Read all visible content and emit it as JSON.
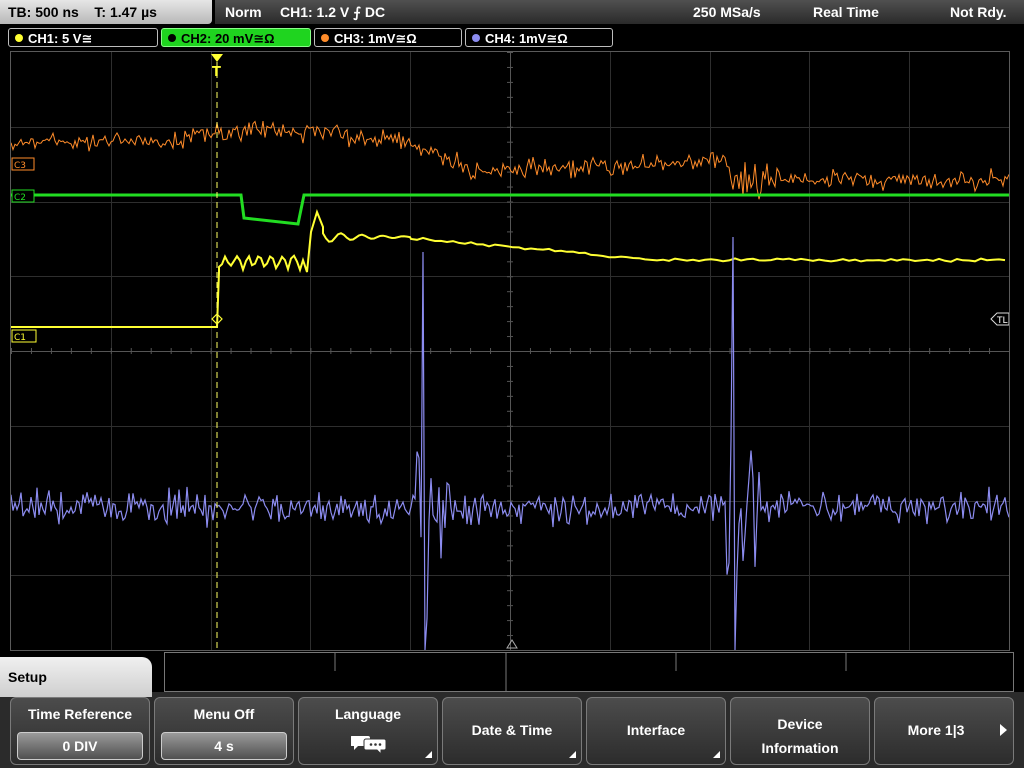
{
  "top": {
    "timebase_label": "TB:",
    "timebase_value": "500 ns",
    "trigger_time_label": "T:",
    "trigger_time_value": "1.47 µs",
    "trigger_mode": "Norm",
    "trigger_source": "CH1: 1.2 V ⨍ DC",
    "sample_rate": "250 MSa/s",
    "acquisition_mode": "Real Time",
    "status": "Not Rdy."
  },
  "channels": [
    {
      "label": "CH1: 5 V≅",
      "color": "#ffff33"
    },
    {
      "label": "CH2: 20 mV≅Ω",
      "color": "#22dd22"
    },
    {
      "label": "CH3: 1mV≅Ω",
      "color": "#ff8c2a"
    },
    {
      "label": "CH4: 1mV≅Ω",
      "color": "#8c8cf0"
    }
  ],
  "markers": {
    "c1": "C1",
    "c2": "C2",
    "c3": "C3",
    "trigger_level": "TL",
    "trigger_position": "T"
  },
  "menu": {
    "title": "Setup",
    "time_reference_label": "Time Reference",
    "time_reference_value": "0 DIV",
    "menu_off_label": "Menu Off",
    "menu_off_value": "4 s",
    "language_label": "Language",
    "language_icon": "speech-bubbles-icon",
    "date_time_label": "Date & Time",
    "interface_label": "Interface",
    "device_info_line1": "Device",
    "device_info_line2": "Information",
    "more_label": "More 1|3"
  }
}
